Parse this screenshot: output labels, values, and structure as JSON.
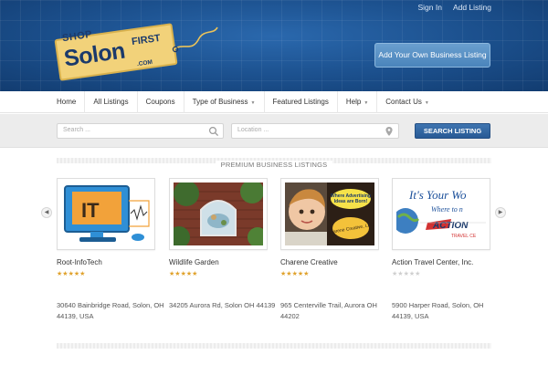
{
  "header": {
    "top_links": [
      "Sign In",
      "Add Listing"
    ],
    "logo_text": {
      "shop": "SHOP",
      "solon": "Solon",
      "first": "FIRST",
      "com": ".COM"
    },
    "add_business_label": "Add Your Own Business Listing"
  },
  "nav": {
    "items": [
      {
        "label": "Home",
        "dropdown": false
      },
      {
        "label": "All Listings",
        "dropdown": false
      },
      {
        "label": "Coupons",
        "dropdown": false
      },
      {
        "label": "Type of Business",
        "dropdown": true
      },
      {
        "label": "Featured Listings",
        "dropdown": false
      },
      {
        "label": "Help",
        "dropdown": true
      },
      {
        "label": "Contact Us",
        "dropdown": true
      }
    ]
  },
  "search": {
    "keyword_placeholder": "Search ...",
    "location_placeholder": "Location ...",
    "button_label": "SEARCH LISTING"
  },
  "section": {
    "title": "PREMIUM BUSINESS LISTINGS"
  },
  "listings": [
    {
      "title": "Root-InfoTech",
      "rating": 5,
      "address": "30640 Bainbridge Road, Solon, OH 44139, USA",
      "image": "it-computer-icon"
    },
    {
      "title": "Wildlife Garden",
      "rating": 5,
      "address": "34205 Aurora Rd, Solon OH 44139",
      "image": "wildlife-mural"
    },
    {
      "title": "Charene Creative",
      "rating": 5,
      "address": "965 Centerville Trail, Aurora OH 44202",
      "image": "child-advertising"
    },
    {
      "title": "Action Travel Center, Inc.",
      "rating": 0,
      "address": "5900 Harper Road, Solon, OH 44139, USA",
      "image": "travel-banner"
    }
  ],
  "thumb_text": {
    "it": "IT",
    "charene_bubble": "Where Advertising Ideas are Born!",
    "charene_brand": "Charene Creative, LLC",
    "travel_line1": "It's Your Wo",
    "travel_line2": "Where to n",
    "travel_brand": "ACTION",
    "travel_sub": "TRAVEL CE"
  },
  "colors": {
    "header_blue": "#1b4f8c",
    "search_button": "#285a95",
    "star_gold": "#e0a22c",
    "star_empty": "#cfcfcf"
  }
}
